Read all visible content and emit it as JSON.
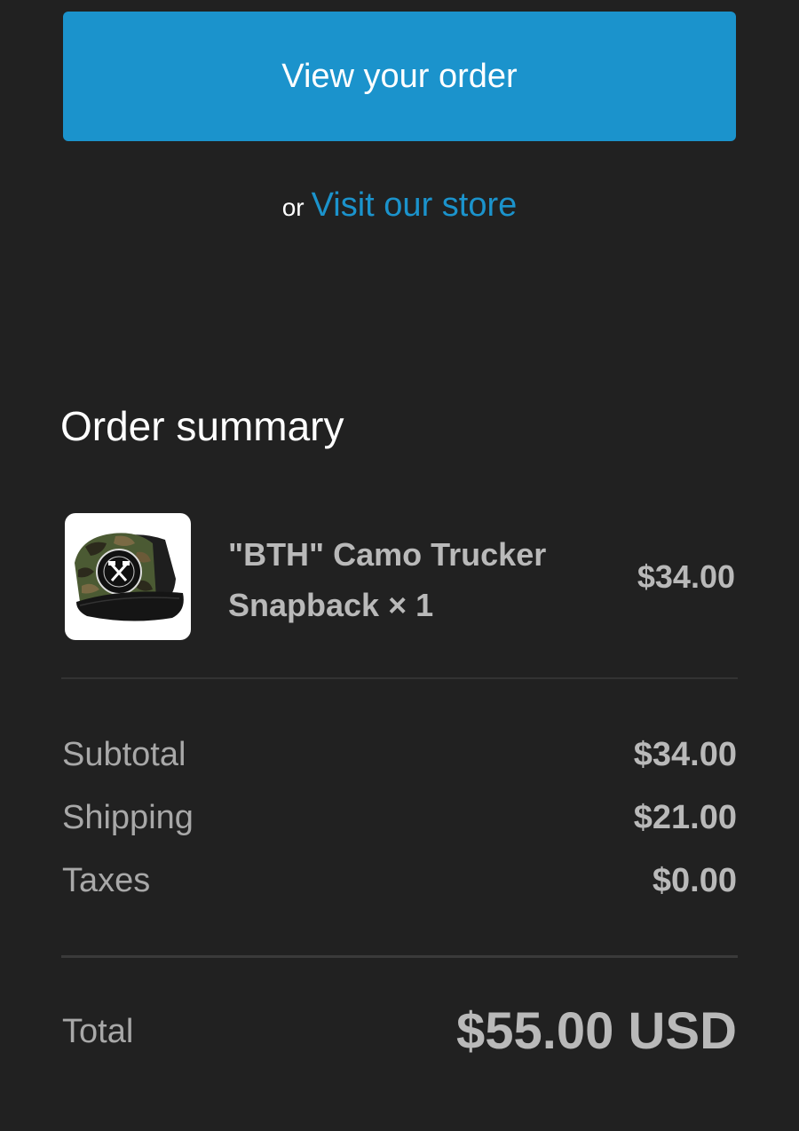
{
  "actions": {
    "view_order_label": "View your order",
    "or_text": "or",
    "visit_store_label": "Visit our store"
  },
  "order_summary": {
    "title": "Order summary",
    "items": [
      {
        "name": "\"BTH\" Camo Trucker Snapback × 1",
        "price": "$34.00",
        "thumbnail_icon": "camo-trucker-cap"
      }
    ],
    "rows": [
      {
        "label": "Subtotal",
        "value": "$34.00"
      },
      {
        "label": "Shipping",
        "value": "$21.00"
      },
      {
        "label": "Taxes",
        "value": "$0.00"
      }
    ],
    "total": {
      "label": "Total",
      "value": "$55.00 USD"
    }
  },
  "colors": {
    "background": "#212121",
    "accent": "#1b93cc",
    "text_primary": "#ffffff",
    "text_muted": "#b9b9b9"
  }
}
